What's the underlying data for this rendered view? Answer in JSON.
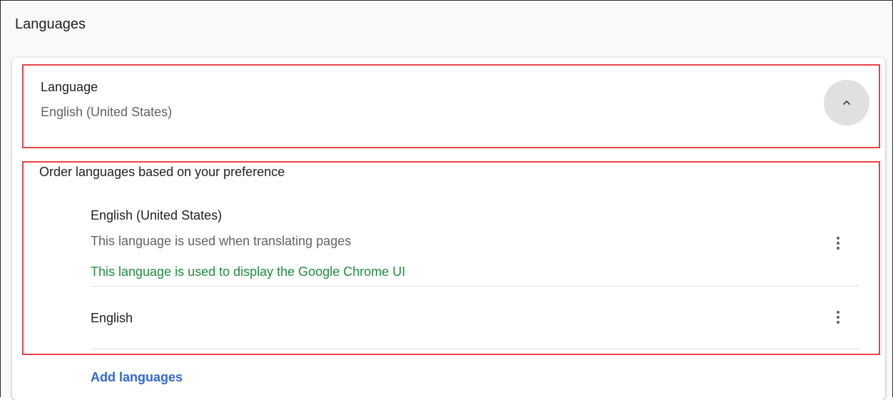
{
  "page": {
    "section_title": "Languages"
  },
  "language_card": {
    "title": "Language",
    "current": "English (United States)",
    "collapse_icon": "chevron-up-icon"
  },
  "order_section": {
    "heading": "Order languages based on your preference",
    "languages": [
      {
        "name": "English (United States)",
        "note": "This language is used when translating pages",
        "ui_note": "This language is used to display the Google Chrome UI",
        "menu_icon": "more-vert-icon"
      },
      {
        "name": "English",
        "menu_icon": "more-vert-icon"
      }
    ],
    "add_label": "Add languages"
  },
  "colors": {
    "highlight": "#e8424b",
    "green": "#1e8e3e",
    "link": "#3367d6"
  }
}
